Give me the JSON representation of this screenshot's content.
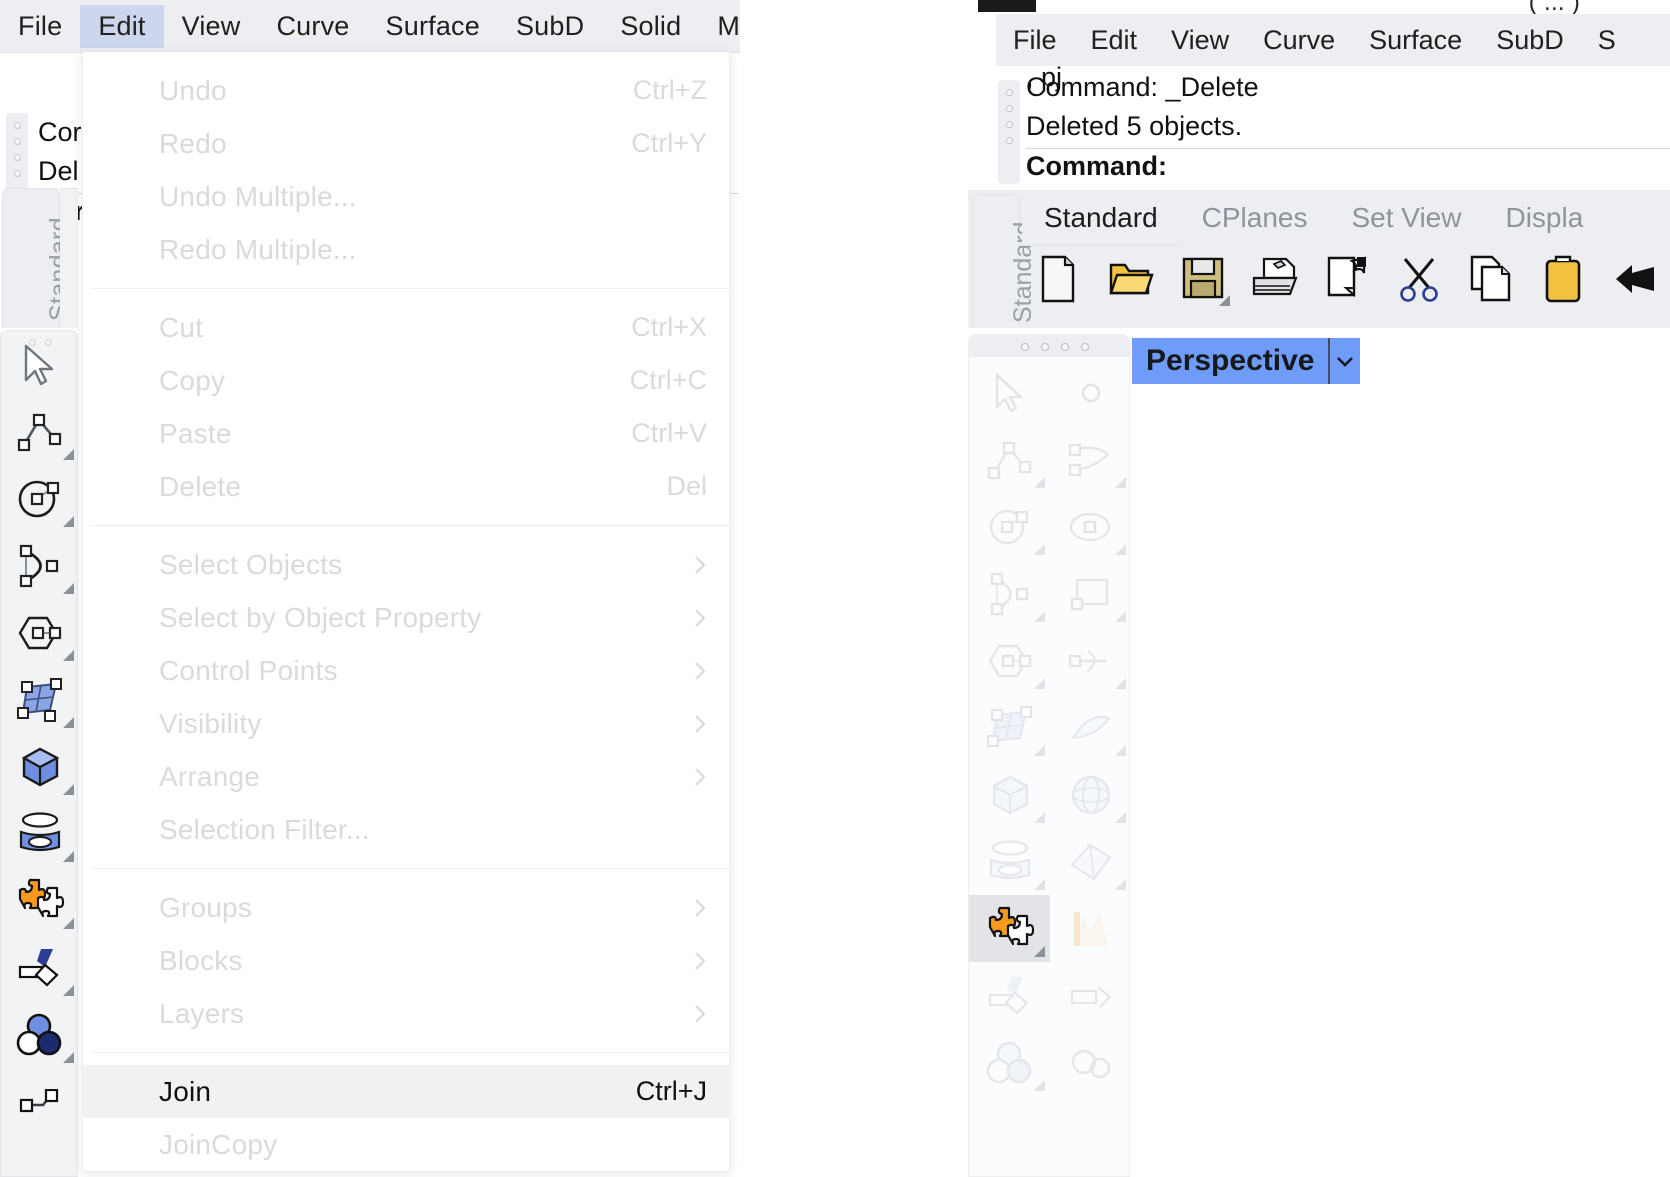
{
  "left_window": {
    "menubar": {
      "items": [
        {
          "label": "File",
          "selected": false
        },
        {
          "label": "Edit",
          "selected": true
        },
        {
          "label": "View",
          "selected": false
        },
        {
          "label": "Curve",
          "selected": false
        },
        {
          "label": "Surface",
          "selected": false
        },
        {
          "label": "SubD",
          "selected": false
        },
        {
          "label": "Solid",
          "selected": false
        },
        {
          "label": "Me",
          "selected": false
        }
      ]
    },
    "command_history": {
      "line1": "Cor",
      "line2": "Del",
      "prompt": "Cor"
    },
    "tabstrip": {
      "label": "Standard"
    },
    "palette": {
      "icons": [
        "select-arrow-icon",
        "polyline-icon",
        "circle-icon",
        "arc-icon",
        "polygon-icon",
        "surface-icon",
        "box-icon",
        "cylinder-icon",
        "join-puzzle-icon",
        "boolean-icon",
        "circles-icon",
        "more-icon"
      ]
    }
  },
  "edit_menu": {
    "groups": [
      {
        "items": [
          {
            "label": "Undo",
            "shortcut": "Ctrl+Z",
            "enabled": false,
            "submenu": false
          },
          {
            "label": "Redo",
            "shortcut": "Ctrl+Y",
            "enabled": false,
            "submenu": false
          },
          {
            "label": "Undo Multiple...",
            "shortcut": "",
            "enabled": false,
            "submenu": false
          },
          {
            "label": "Redo Multiple...",
            "shortcut": "",
            "enabled": false,
            "submenu": false
          }
        ]
      },
      {
        "items": [
          {
            "label": "Cut",
            "shortcut": "Ctrl+X",
            "enabled": false,
            "submenu": false
          },
          {
            "label": "Copy",
            "shortcut": "Ctrl+C",
            "enabled": false,
            "submenu": false
          },
          {
            "label": "Paste",
            "shortcut": "Ctrl+V",
            "enabled": false,
            "submenu": false
          },
          {
            "label": "Delete",
            "shortcut": "Del",
            "enabled": false,
            "submenu": false
          }
        ]
      },
      {
        "items": [
          {
            "label": "Select Objects",
            "shortcut": "",
            "enabled": false,
            "submenu": true
          },
          {
            "label": "Select by Object Property",
            "shortcut": "",
            "enabled": false,
            "submenu": true
          },
          {
            "label": "Control Points",
            "shortcut": "",
            "enabled": false,
            "submenu": true
          },
          {
            "label": "Visibility",
            "shortcut": "",
            "enabled": false,
            "submenu": true
          },
          {
            "label": "Arrange",
            "shortcut": "",
            "enabled": false,
            "submenu": true
          },
          {
            "label": "Selection Filter...",
            "shortcut": "",
            "enabled": false,
            "submenu": false
          }
        ]
      },
      {
        "items": [
          {
            "label": "Groups",
            "shortcut": "",
            "enabled": false,
            "submenu": true
          },
          {
            "label": "Blocks",
            "shortcut": "",
            "enabled": false,
            "submenu": true
          },
          {
            "label": "Layers",
            "shortcut": "",
            "enabled": false,
            "submenu": true
          }
        ]
      },
      {
        "items": [
          {
            "label": "Join",
            "shortcut": "Ctrl+J",
            "enabled": true,
            "submenu": false,
            "highlighted": true
          },
          {
            "label": "JoinCopy",
            "shortcut": "",
            "enabled": false,
            "submenu": false
          }
        ]
      }
    ]
  },
  "right_window": {
    "titlebar": {
      "trailing_text": "( ... )"
    },
    "menubar": {
      "items": [
        {
          "label": "File"
        },
        {
          "label": "Edit"
        },
        {
          "label": "View"
        },
        {
          "label": "Curve"
        },
        {
          "label": "Surface"
        },
        {
          "label": "SubD"
        },
        {
          "label": "S"
        }
      ]
    },
    "command_history": {
      "line0": ", pj",
      "line1": "Command: _Delete",
      "line2": "Deleted 5 objects.",
      "prompt": "Command:"
    },
    "toolbar": {
      "vertical_label": "Standard",
      "tabs": [
        {
          "label": "Standard",
          "active": true
        },
        {
          "label": "CPlanes",
          "active": false
        },
        {
          "label": "Set View",
          "active": false
        },
        {
          "label": "Displa",
          "active": false
        }
      ],
      "buttons": [
        {
          "name": "new-file-icon",
          "has_flyout": false
        },
        {
          "name": "open-folder-icon",
          "has_flyout": false
        },
        {
          "name": "save-floppy-icon",
          "has_flyout": true
        },
        {
          "name": "print-icon",
          "has_flyout": false
        },
        {
          "name": "copy-to-clipboard-icon",
          "has_flyout": false
        },
        {
          "name": "cut-scissors-icon",
          "has_flyout": false
        },
        {
          "name": "copy-pages-icon",
          "has_flyout": false
        },
        {
          "name": "paste-clipboard-icon",
          "has_flyout": false
        },
        {
          "name": "undo-arrow-icon",
          "has_flyout": false
        }
      ]
    },
    "palette": {
      "icons": [
        {
          "name": "select-arrow-icon",
          "flyout": false,
          "highlighted": false
        },
        {
          "name": "control-point-icon",
          "flyout": false,
          "highlighted": false
        },
        {
          "name": "polyline-icon",
          "flyout": true,
          "highlighted": false
        },
        {
          "name": "freeform-curve-icon",
          "flyout": true,
          "highlighted": false
        },
        {
          "name": "circle-icon",
          "flyout": true,
          "highlighted": false
        },
        {
          "name": "ellipse-icon",
          "flyout": true,
          "highlighted": false
        },
        {
          "name": "arc-icon",
          "flyout": true,
          "highlighted": false
        },
        {
          "name": "rectangle-icon",
          "flyout": true,
          "highlighted": false
        },
        {
          "name": "polygon-icon",
          "flyout": true,
          "highlighted": false
        },
        {
          "name": "curve-from-object-icon",
          "flyout": true,
          "highlighted": false
        },
        {
          "name": "surface-icon",
          "flyout": true,
          "highlighted": false
        },
        {
          "name": "loft-surface-icon",
          "flyout": true,
          "highlighted": false
        },
        {
          "name": "box-icon",
          "flyout": true,
          "highlighted": false
        },
        {
          "name": "sphere-icon",
          "flyout": true,
          "highlighted": false
        },
        {
          "name": "cylinder-icon",
          "flyout": true,
          "highlighted": false
        },
        {
          "name": "subd-icon",
          "flyout": true,
          "highlighted": false
        },
        {
          "name": "join-puzzle-icon",
          "flyout": true,
          "highlighted": true
        },
        {
          "name": "explode-icon",
          "flyout": false,
          "highlighted": false
        },
        {
          "name": "boolean-icon",
          "flyout": false,
          "highlighted": false
        },
        {
          "name": "trim-icon",
          "flyout": false,
          "highlighted": false
        },
        {
          "name": "circles-icon",
          "flyout": true,
          "highlighted": false
        },
        {
          "name": "boolean-two-icon",
          "flyout": false,
          "highlighted": false
        }
      ]
    },
    "viewport": {
      "tab_label": "Perspective",
      "dropdown_icon": "chevron-down-icon"
    }
  },
  "colors": {
    "menu_highlight": "#ccd6ec",
    "menubar_bg": "#eceef1",
    "viewport_tab_bg": "#6f9cf8",
    "disabled_text": "#d8dadd",
    "enabled_text": "#111111",
    "join_row_bg": "#f1f1f1",
    "palette_hot_bg": "#e2e4e8",
    "folder_yellow": "#f5c542",
    "puzzle_orange": "#f59a1e"
  }
}
